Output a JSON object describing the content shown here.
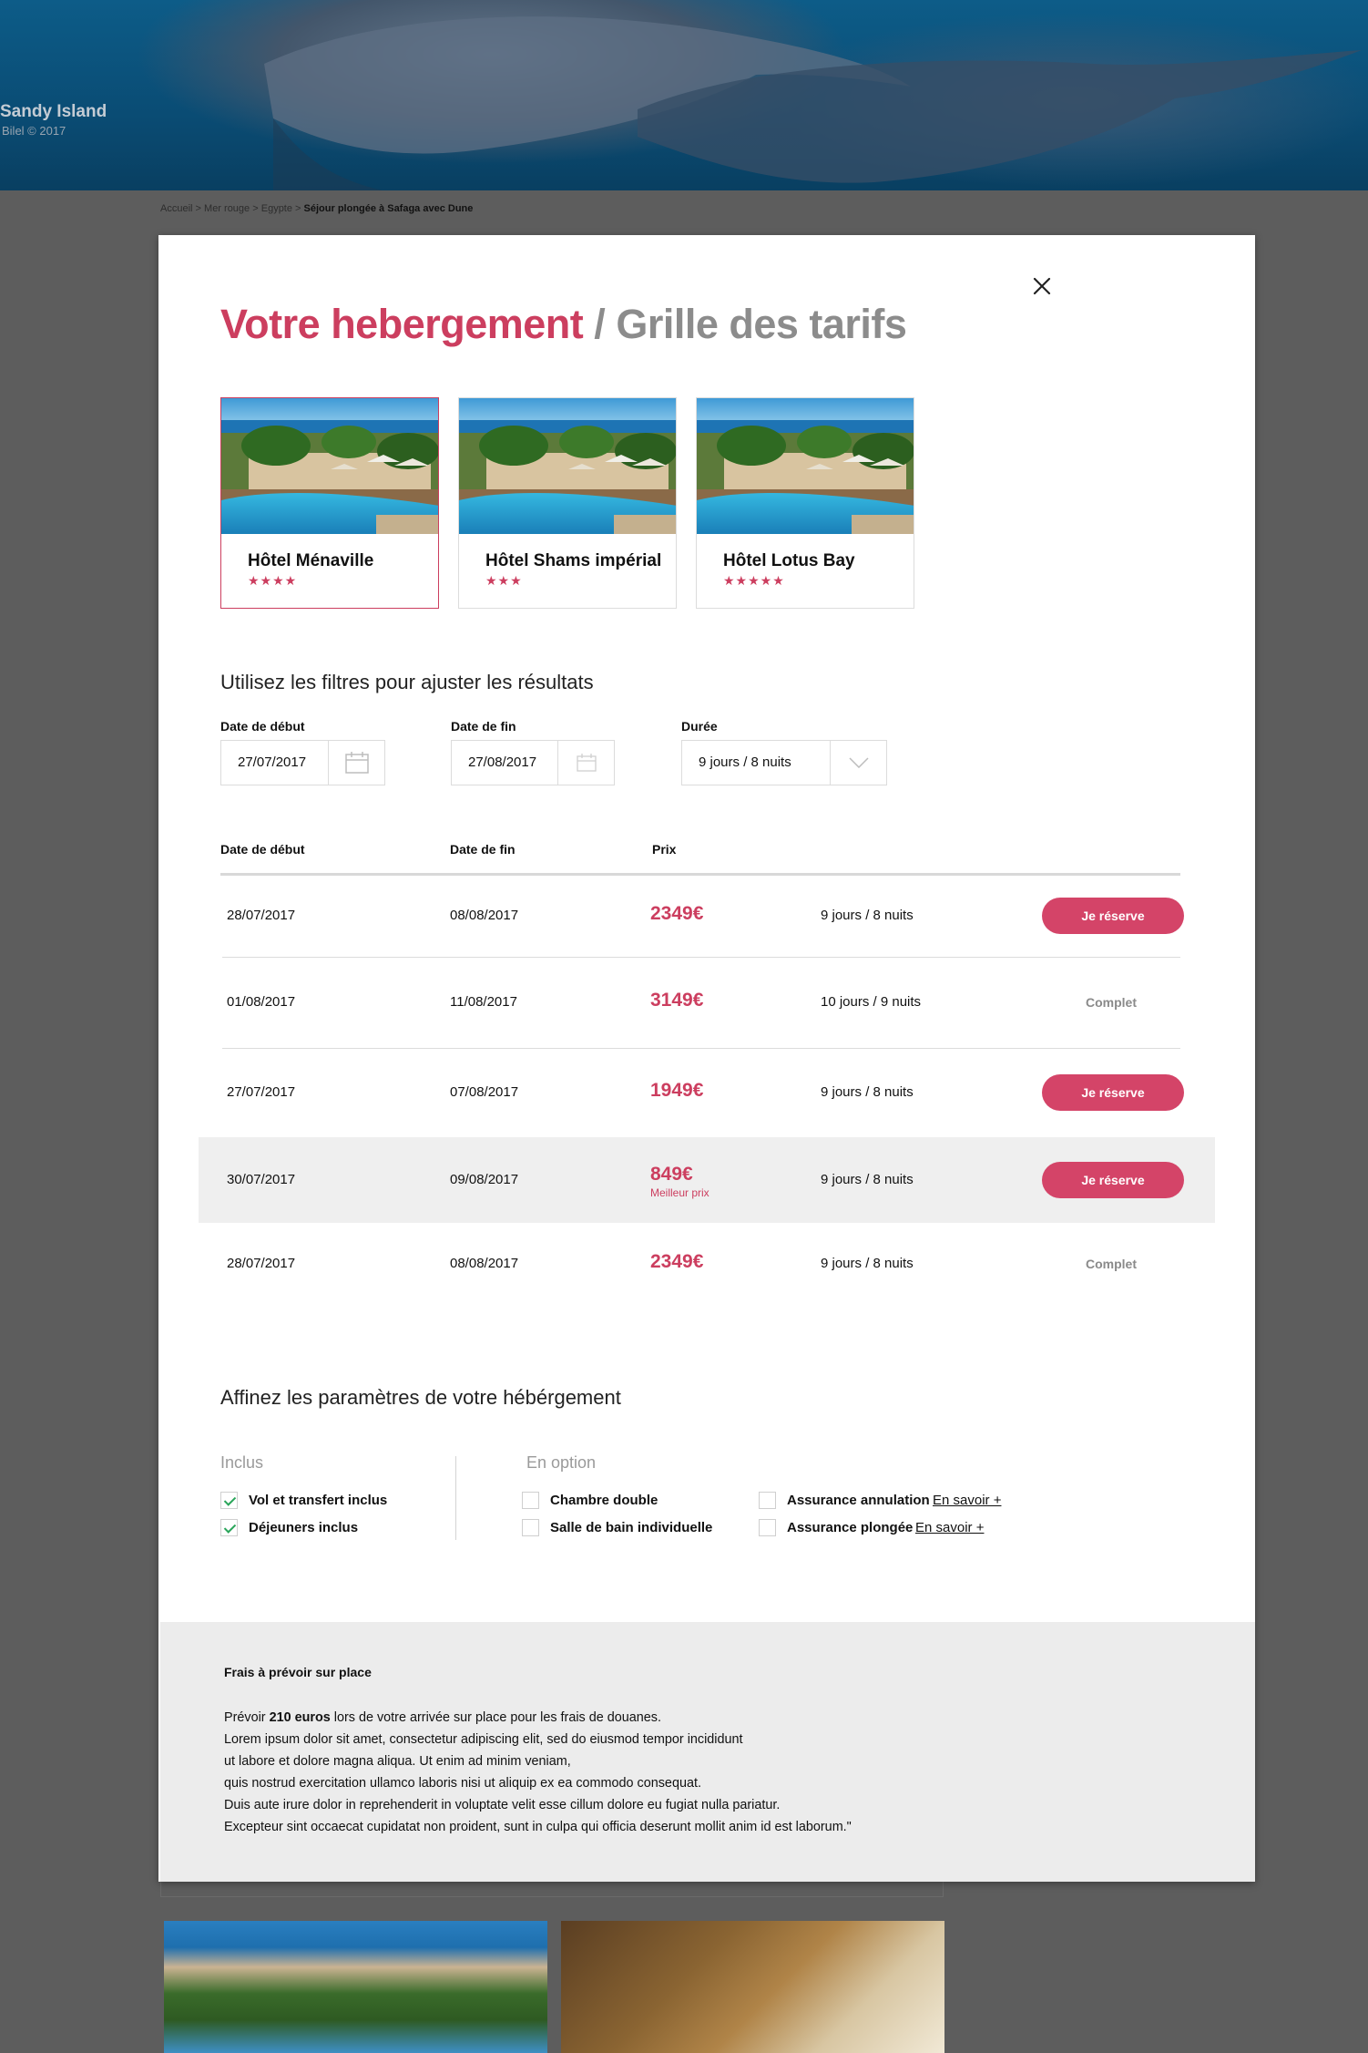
{
  "hero": {
    "title": "Sandy Island",
    "credit": "Bilel © 2017"
  },
  "breadcrumb": {
    "items": [
      "Accueil",
      "Mer rouge",
      "Egypte"
    ],
    "current": "Séjour plongée à Safaga avec Dune",
    "separator": ">"
  },
  "modal": {
    "title_main": "Votre hebergement",
    "title_sep": "/",
    "title_sub": "Grille des tarifs",
    "close_icon": "close-icon",
    "accent_color": "#cc3e5f"
  },
  "hotels": [
    {
      "name": "Hôtel Ménaville",
      "stars": "★★★★",
      "star_count": 4,
      "selected": true
    },
    {
      "name": "Hôtel Shams impérial",
      "stars": "★★★",
      "star_count": 3,
      "selected": false
    },
    {
      "name": "Hôtel Lotus Bay",
      "stars": "★★★★★",
      "star_count": 5,
      "selected": false
    }
  ],
  "filters": {
    "heading": "Utilisez les filtres pour ajuster les résultats",
    "start": {
      "label": "Date de début",
      "value": "27/07/2017",
      "icon": "calendar-icon"
    },
    "end": {
      "label": "Date de fin",
      "value": "27/08/2017",
      "icon": "calendar-icon"
    },
    "duration": {
      "label": "Durée",
      "value": "9 jours / 8 nuits",
      "icon": "chevron-down-icon"
    }
  },
  "table": {
    "headers": {
      "start": "Date de début",
      "end": "Date de fin",
      "price": "Prix"
    },
    "rows": [
      {
        "start": "28/07/2017",
        "end": "08/08/2017",
        "price": "2349€",
        "duration": "9 jours / 8 nuits",
        "action": "Je réserve",
        "available": true
      },
      {
        "start": "01/08/2017",
        "end": "11/08/2017",
        "price": "3149€",
        "duration": "10 jours / 9 nuits",
        "action": "Complet",
        "available": false
      },
      {
        "start": "27/07/2017",
        "end": "07/08/2017",
        "price": "1949€",
        "duration": "9 jours / 8 nuits",
        "action": "Je réserve",
        "available": true
      },
      {
        "start": "30/07/2017",
        "end": "09/08/2017",
        "price": "849€",
        "price_note": "Meilleur prix",
        "duration": "9 jours / 8 nuits",
        "action": "Je réserve",
        "available": true
      },
      {
        "start": "28/07/2017",
        "end": "08/08/2017",
        "price": "2349€",
        "duration": "9 jours / 8 nuits",
        "action": "Complet",
        "available": false
      }
    ]
  },
  "options": {
    "heading": "Affinez les paramètres de votre hébérgement",
    "included_title": "Inclus",
    "included": [
      {
        "label": "Vol et transfert inclus",
        "checked": true
      },
      {
        "label": "Déjeuners inclus",
        "checked": true
      }
    ],
    "optional_title": "En option",
    "optional": [
      {
        "label": "Chambre double",
        "checked": false
      },
      {
        "label": "Salle de bain individuelle",
        "checked": false
      },
      {
        "label": "Assurance annulation",
        "checked": false,
        "link": "En savoir +"
      },
      {
        "label": "Assurance plongée",
        "checked": false,
        "link": "En savoir +"
      }
    ]
  },
  "fees": {
    "title": "Frais à prévoir sur place",
    "line1_prefix": "Prévoir ",
    "line1_bold": "210 euros",
    "line1_suffix": " lors de votre arrivée sur place pour les frais de douanes.",
    "lines": [
      "Lorem ipsum dolor sit amet, consectetur adipiscing elit, sed do eiusmod tempor incididunt",
      "ut labore et dolore magna aliqua. Ut enim ad minim veniam,",
      "quis nostrud exercitation ullamco laboris nisi ut aliquip ex ea commodo consequat.",
      "Duis aute irure dolor in reprehenderit in voluptate velit esse cillum dolore eu fugiat nulla pariatur.",
      "Excepteur sint occaecat cupidatat non proident, sunt in culpa qui officia deserunt mollit anim id est laborum.\""
    ]
  }
}
